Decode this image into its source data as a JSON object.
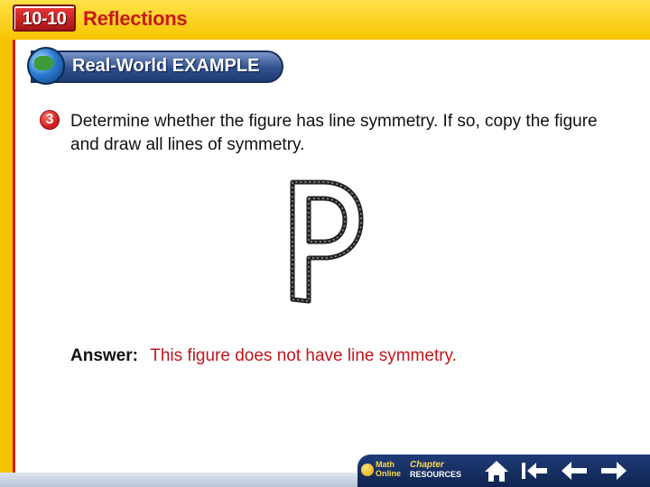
{
  "header": {
    "lesson_number": "10-10",
    "lesson_title": "Reflections"
  },
  "banner": {
    "label": "Real-World EXAMPLE"
  },
  "example": {
    "step_number": "3",
    "question": "Determine whether the figure has line symmetry. If so, copy the figure and draw all lines of symmetry.",
    "figure_letter": "P",
    "answer_label": "Answer:",
    "answer_text": "This figure does not have line symmetry."
  },
  "navigation": {
    "math_online_label": "Math Online",
    "chapter_resources_label_top": "Chapter",
    "chapter_resources_label_bottom": "RESOURCES",
    "buttons": [
      "home-icon",
      "first-slide-icon",
      "previous-slide-icon",
      "next-slide-icon"
    ]
  },
  "colors": {
    "header": "#f7c400",
    "accent_red": "#c81818",
    "banner_blue": "#2f4f8f",
    "answer_text": "#c0161c"
  }
}
